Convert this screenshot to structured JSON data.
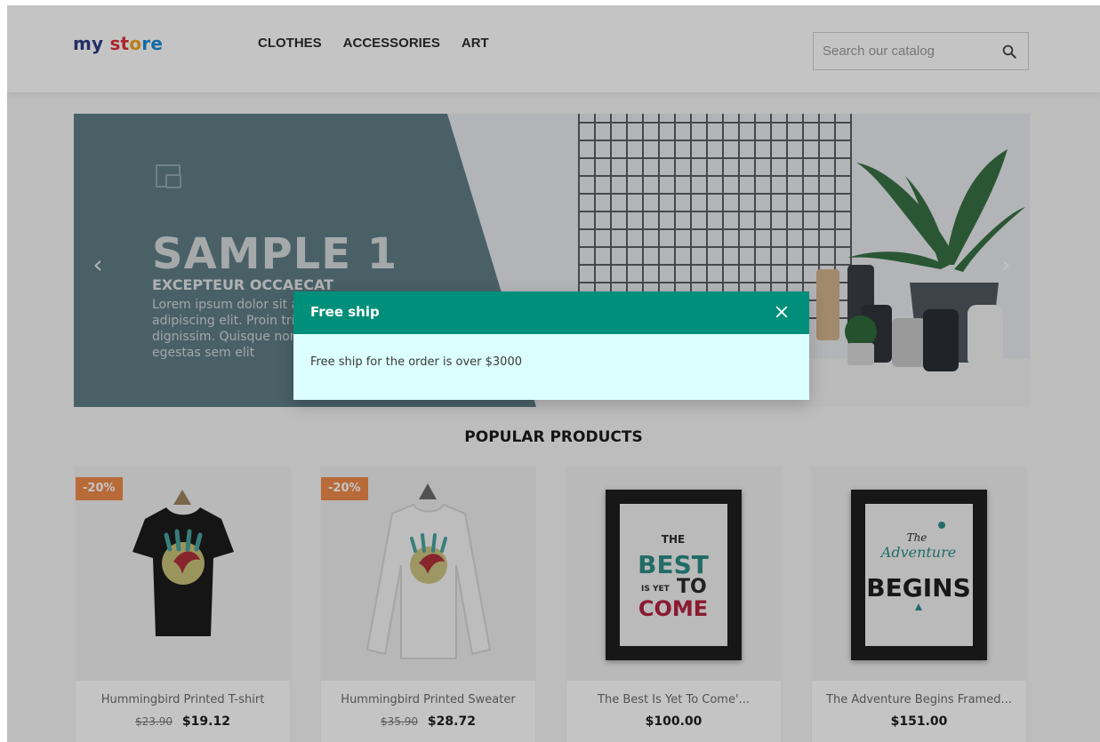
{
  "brand": {
    "logo_part1": "my",
    "logo_part2": "st",
    "logo_part3": "o",
    "logo_part4": "re",
    "colors": {
      "my": "#2f3d84",
      "st": "#e0313c",
      "o": "#f5a623",
      "re": "#1a8bd6"
    }
  },
  "nav": {
    "items": [
      {
        "label": "CLOTHES"
      },
      {
        "label": "ACCESSORIES"
      },
      {
        "label": "ART"
      }
    ]
  },
  "search": {
    "placeholder": "Search our catalog",
    "icon": "search-icon"
  },
  "hero": {
    "title": "SAMPLE 1",
    "subtitle": "EXCEPTEUR OCCAECAT",
    "description": "Lorem ipsum dolor sit amet, consectetur adipiscing elit. Proin tristique in tortor et dignissim. Quisque non tempor leo. Maecenas egestas sem elit",
    "prev_icon": "chevron-left-icon",
    "next_icon": "chevron-right-icon"
  },
  "section": {
    "title": "POPULAR PRODUCTS"
  },
  "products": [
    {
      "badge": "-20%",
      "name": "Hummingbird Printed T-shirt",
      "old_price": "$23.90",
      "price": "$19.12"
    },
    {
      "badge": "-20%",
      "name": "Hummingbird Printed Sweater",
      "old_price": "$35.90",
      "price": "$28.72"
    },
    {
      "badge": "",
      "name": "The Best Is Yet To Come'...",
      "old_price": "",
      "price": "$100.00"
    },
    {
      "badge": "",
      "name": "The Adventure Begins Framed...",
      "old_price": "",
      "price": "$151.00"
    }
  ],
  "modal": {
    "title": "Free ship",
    "body": "Free ship for the order is over $3000",
    "close_icon": "close-icon",
    "header_color": "#008f7a",
    "body_color": "#dcffff"
  },
  "poster1": {
    "line1": "THE",
    "line2": "BEST",
    "line3": "IS YET",
    "line4": "TO",
    "line5": "COME"
  },
  "poster2": {
    "line1": "The",
    "line2": "Adventure",
    "line3": "BEGINS"
  }
}
